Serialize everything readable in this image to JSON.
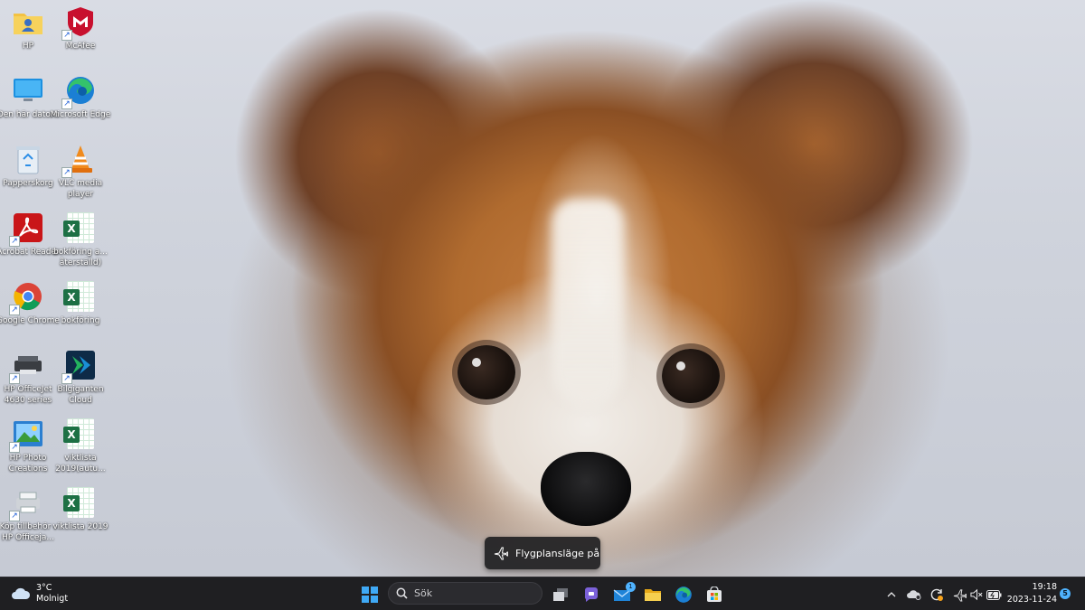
{
  "desktop": {
    "icons": [
      {
        "label": "HP"
      },
      {
        "label": "McAfee"
      },
      {
        "label": "Den här datorn"
      },
      {
        "label": "Microsoft Edge"
      },
      {
        "label": "Papperskorg"
      },
      {
        "label": "VLC media player"
      },
      {
        "label": "Acrobat Reader"
      },
      {
        "label": "bokföring a... återställd)"
      },
      {
        "label": "Google Chrome"
      },
      {
        "label": "bokföring"
      },
      {
        "label": "HP OfficeJet 4630 series"
      },
      {
        "label": "Bilgiganten Cloud"
      },
      {
        "label": "HP Photo Creations"
      },
      {
        "label": "viktlista 2019(autu..."
      },
      {
        "label": "Köp tillbehör - HP Officeja..."
      },
      {
        "label": "viktlista 2019"
      }
    ]
  },
  "toast": {
    "icon": "airplane-icon",
    "text": "Flygplansläge på"
  },
  "taskbar": {
    "weather": {
      "temp": "3°C",
      "condition": "Molnigt",
      "icon": "cloud-icon"
    },
    "search": {
      "placeholder": "Sök"
    },
    "apps": [
      {
        "name": "Start",
        "icon": "windows-logo-icon"
      },
      {
        "name": "Task View",
        "icon": "task-view-icon"
      },
      {
        "name": "Teams Chat",
        "icon": "chat-icon"
      },
      {
        "name": "Mail",
        "icon": "mail-icon",
        "badge": "1"
      },
      {
        "name": "File Explorer",
        "icon": "folder-icon"
      },
      {
        "name": "Microsoft Edge",
        "icon": "edge-icon"
      },
      {
        "name": "Microsoft Store",
        "icon": "store-icon"
      }
    ],
    "tray": {
      "chevron": "^",
      "time": "19:18",
      "date": "2023-11-24",
      "notification_count": "5"
    }
  },
  "colors": {
    "taskbar_bg": "#1f1f22",
    "accent": "#4fb3ff",
    "excel_green": "#1d7044"
  }
}
